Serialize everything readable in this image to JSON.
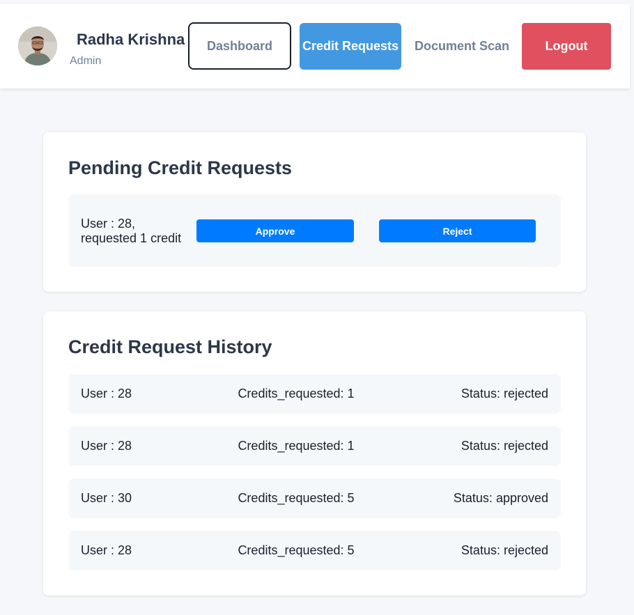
{
  "header": {
    "user_name": "Radha Krishna",
    "user_role": "Admin",
    "nav": {
      "dashboard": "Dashboard",
      "credit_requests": "Credit Requests",
      "document_scan": "Document Scan",
      "logout": "Logout"
    }
  },
  "pending": {
    "title": "Pending Credit Requests",
    "requests": [
      {
        "text": "User : 28, requested 1 credit",
        "approve_label": "Approve",
        "reject_label": "Reject"
      }
    ]
  },
  "history": {
    "title": "Credit Request History",
    "rows": [
      {
        "user": "User : 28",
        "credits": "Credits_requested: 1",
        "status": "Status: rejected"
      },
      {
        "user": "User : 28",
        "credits": "Credits_requested: 1",
        "status": "Status: rejected"
      },
      {
        "user": "User : 30",
        "credits": "Credits_requested: 5",
        "status": "Status: approved"
      },
      {
        "user": "User : 28",
        "credits": "Credits_requested: 5",
        "status": "Status: rejected"
      }
    ]
  },
  "colors": {
    "accent_blue": "#4299e1",
    "action_blue": "#007bff",
    "logout_red": "#e0505e",
    "background": "#f5f7fa"
  },
  "icons": {
    "avatar": "user-photo"
  }
}
